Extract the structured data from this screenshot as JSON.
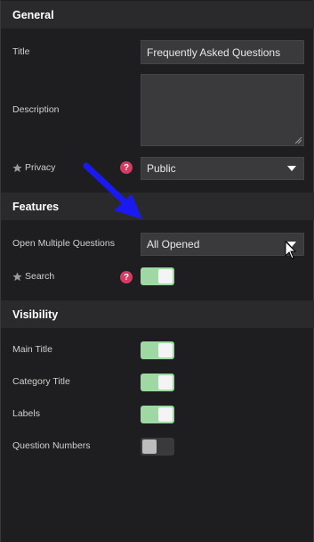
{
  "sections": {
    "general": "General",
    "features": "Features",
    "visibility": "Visibility"
  },
  "general": {
    "title_label": "Title",
    "title_value": "Frequently Asked Questions",
    "description_label": "Description",
    "description_value": "",
    "privacy_label": "Privacy",
    "privacy_value": "Public",
    "help_glyph": "?"
  },
  "features": {
    "open_multiple_label": "Open Multiple Questions",
    "open_multiple_value": "All Opened",
    "search_label": "Search",
    "search_on": true,
    "help_glyph": "?"
  },
  "visibility": {
    "main_title_label": "Main Title",
    "main_title_on": true,
    "category_title_label": "Category Title",
    "category_title_on": true,
    "labels_label": "Labels",
    "labels_on": true,
    "question_numbers_label": "Question Numbers",
    "question_numbers_on": false
  },
  "colors": {
    "toggle_on": "#9fd8a4",
    "help_badge": "#d33b63",
    "annotation_arrow": "#1a1af0"
  }
}
